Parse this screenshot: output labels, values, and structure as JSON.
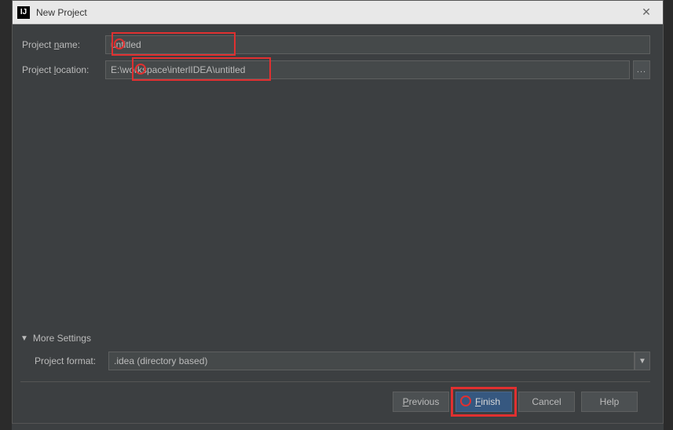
{
  "title": "New Project",
  "fields": {
    "projectName": {
      "label_prefix": "Project ",
      "label_mnemonic": "n",
      "label_suffix": "ame:",
      "value": "untitled"
    },
    "projectLocation": {
      "label_prefix": "Project ",
      "label_mnemonic": "l",
      "label_suffix": "ocation:",
      "value": "E:\\workspace\\interlIDEA\\untitled"
    }
  },
  "moreSettings": {
    "label": "More Settings",
    "expanded": true
  },
  "projectFormat": {
    "label_prefix": "Project ",
    "label_mnemonic": "f",
    "label_suffix": "ormat:",
    "value": ".idea (directory based)"
  },
  "buttons": {
    "previous_mnemonic": "P",
    "previous_rest": "revious",
    "finish_mnemonic": "F",
    "finish_rest": "inish",
    "cancel": "Cancel",
    "help": "Help"
  },
  "browseDots": "..."
}
